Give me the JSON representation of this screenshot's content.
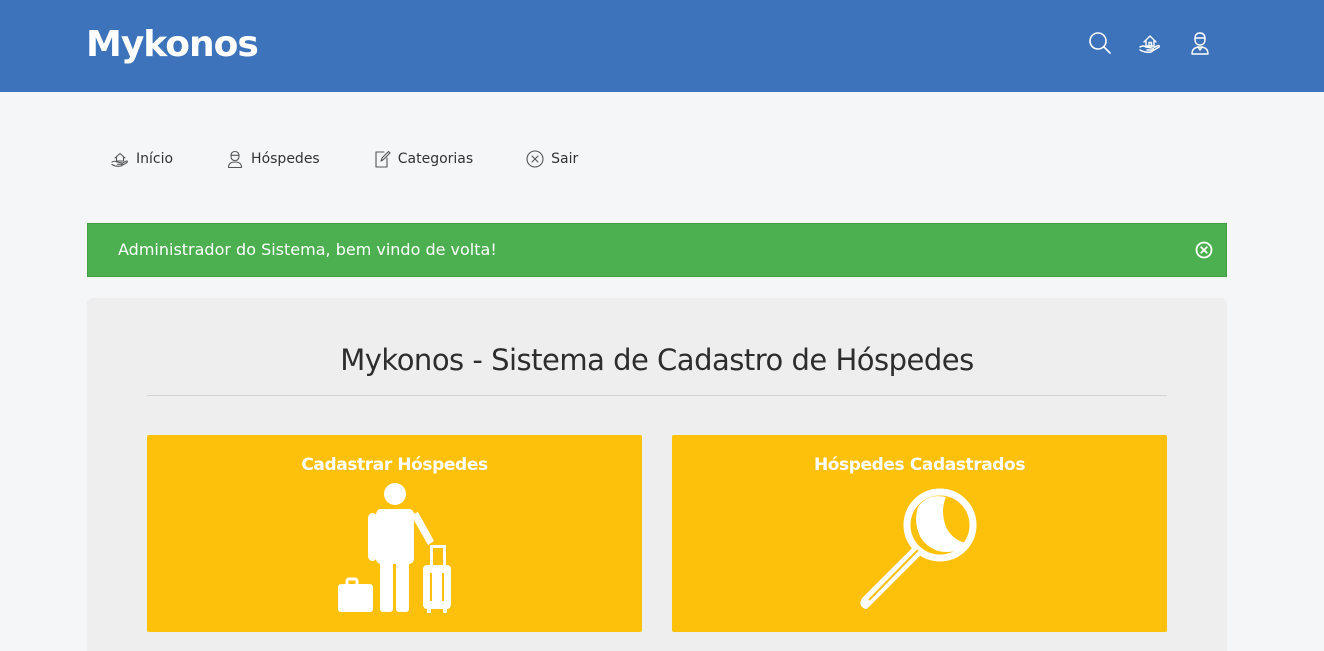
{
  "header": {
    "brand": "Mykonos",
    "icons": [
      "search-icon",
      "home-hand-icon",
      "user-icon"
    ]
  },
  "nav": {
    "items": [
      {
        "label": "Início",
        "icon": "home-hand-icon"
      },
      {
        "label": "Hóspedes",
        "icon": "user-icon"
      },
      {
        "label": "Categorias",
        "icon": "edit-note-icon"
      },
      {
        "label": "Sair",
        "icon": "close-circle-icon"
      }
    ]
  },
  "alert": {
    "message": "Administrador do Sistema, bem vindo de volta!",
    "color": "#4caf50"
  },
  "main": {
    "title": "Mykonos - Sistema de Cadastro de Hóspedes",
    "cards": [
      {
        "label": "Cadastrar Hóspedes",
        "icon": "traveler-luggage-icon"
      },
      {
        "label": "Hóspedes Cadastrados",
        "icon": "magnifier-icon"
      }
    ]
  },
  "colors": {
    "header": "#3d73ba",
    "card": "#fdc10c",
    "alert": "#4caf50",
    "background": "#f5f6f8"
  }
}
